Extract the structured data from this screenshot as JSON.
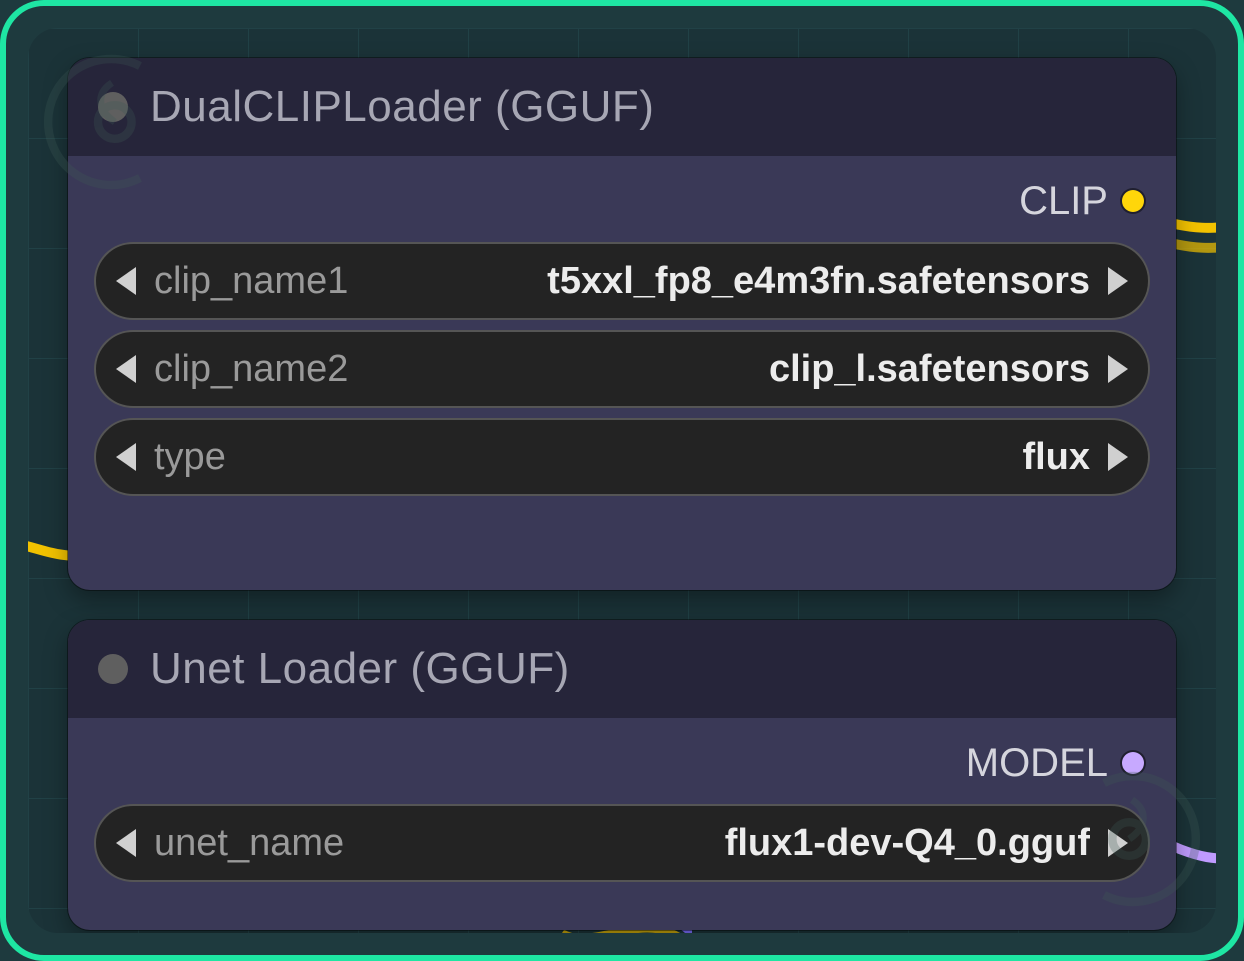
{
  "nodes": [
    {
      "title": "DualCLIPLoader (GGUF)",
      "outputs": [
        {
          "label": "CLIP",
          "color": "yellow"
        }
      ],
      "widgets": [
        {
          "label": "clip_name1",
          "value": "t5xxl_fp8_e4m3fn.safetensors"
        },
        {
          "label": "clip_name2",
          "value": "clip_l.safetensors"
        },
        {
          "label": "type",
          "value": "flux"
        }
      ]
    },
    {
      "title": "Unet Loader (GGUF)",
      "outputs": [
        {
          "label": "MODEL",
          "color": "purple"
        }
      ],
      "widgets": [
        {
          "label": "unet_name",
          "value": "flux1-dev-Q4_0.gguf"
        }
      ]
    }
  ]
}
